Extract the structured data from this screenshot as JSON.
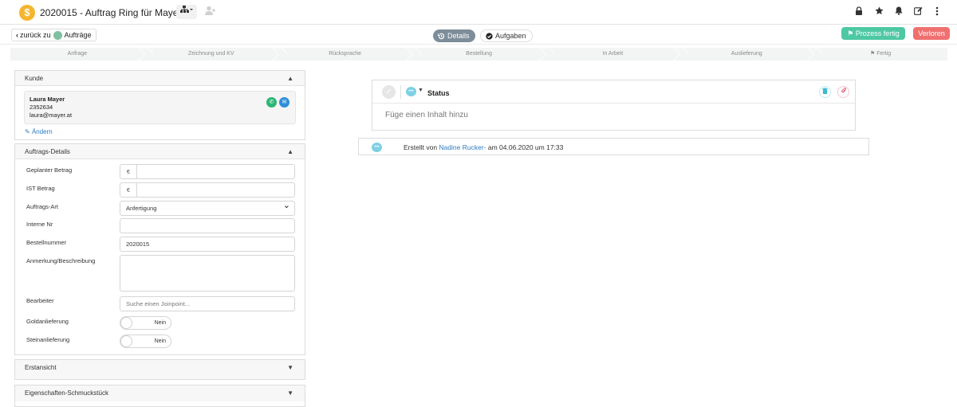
{
  "header": {
    "coin_symbol": "$",
    "title": "2020015 - Auftrag Ring für Mayer"
  },
  "subbar": {
    "back_label": "zurück zu",
    "back_target": "Aufträge",
    "tab_details": "Details",
    "tab_aufgaben": "Aufgaben",
    "btn_fertig": "Prozess fertig",
    "btn_verloren": "Verloren"
  },
  "steps": [
    "Anfrage",
    "Zeichnung und KV",
    "Rücksprache",
    "Bestellung",
    "In Arbeit",
    "Auslieferung",
    "Fertig"
  ],
  "kunde": {
    "title": "Kunde",
    "name": "Laura Mayer",
    "phone": "2352634",
    "email": "laura@mayer.at",
    "aendern": "Ändern"
  },
  "details": {
    "title": "Auftrags-Details",
    "geplanter_label": "Geplanter Betrag",
    "ist_label": "IST Betrag",
    "currency": "€",
    "art_label": "Auftrags-Art",
    "art_value": "Anfertigung",
    "interne_label": "Interne Nr",
    "bestell_label": "Bestellnummer",
    "bestell_value": "2020015",
    "anmerkung_label": "Anmerkung/Beschreibung",
    "bearbeiter_label": "Bearbeiter",
    "bearbeiter_placeholder": "Suche einen Joinpoint...",
    "gold_label": "Goldanlieferung",
    "gold_value": "Nein",
    "stein_label": "Steinanlieferung",
    "stein_value": "Nein"
  },
  "erstansicht": "Erstansicht",
  "eigenschaften": "Eigenschaften-Schmuckstück",
  "status": {
    "label": "Status",
    "placeholder": "Füge einen Inhalt hinzu"
  },
  "log": {
    "prefix": "Erstellt von",
    "who": "Nadine Rucker-",
    "suffix": "am 04.06.2020 um 17:33"
  }
}
